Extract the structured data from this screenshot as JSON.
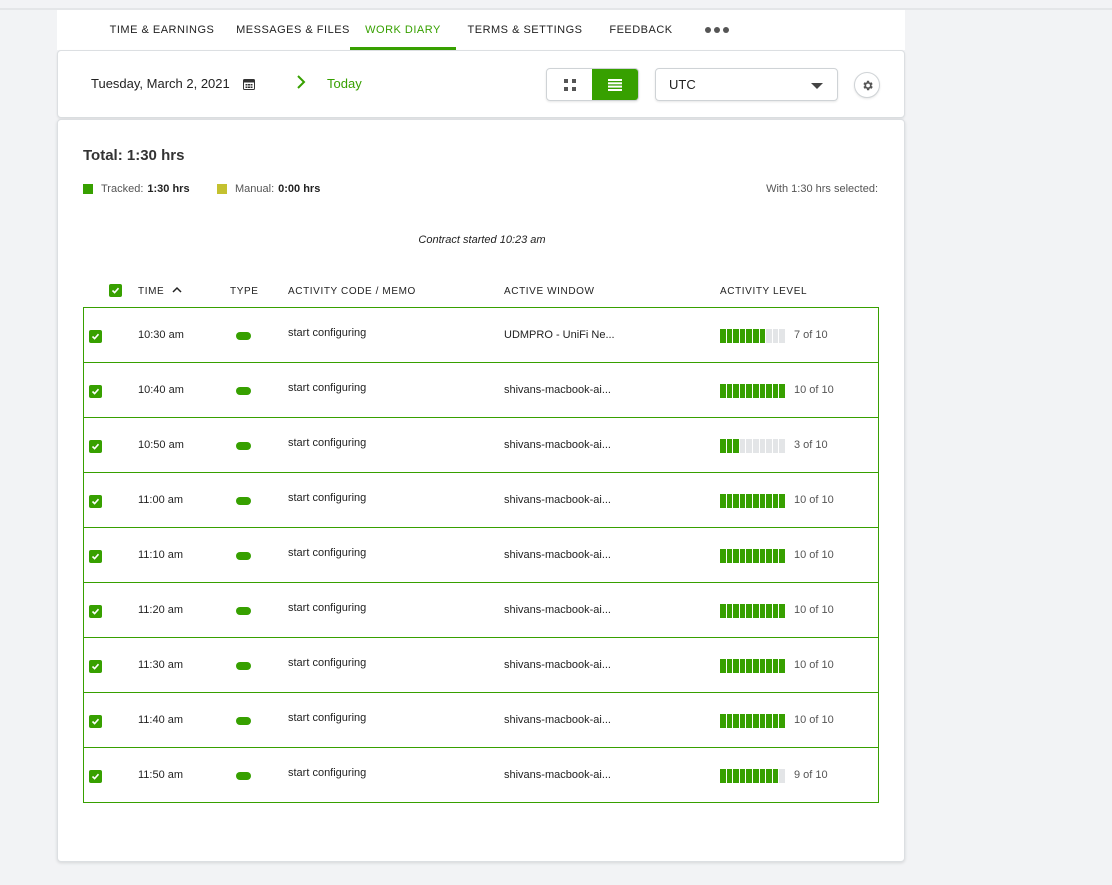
{
  "tabs": [
    {
      "label": "TIME & EARNINGS"
    },
    {
      "label": "MESSAGES & FILES"
    },
    {
      "label": "WORK DIARY"
    },
    {
      "label": "TERMS & SETTINGS"
    },
    {
      "label": "FEEDBACK"
    }
  ],
  "active_tab": "WORK DIARY",
  "toolbar": {
    "date": "Tuesday, March 2, 2021",
    "today_label": "Today",
    "timezone": "UTC",
    "view_mode": "list"
  },
  "summary": {
    "total": "Total: 1:30 hrs",
    "tracked_label": "Tracked:",
    "tracked_value": "1:30 hrs",
    "manual_label": "Manual:",
    "manual_value": "0:00 hrs",
    "selected_note": "With 1:30 hrs selected:",
    "contract_note": "Contract started 10:23 am"
  },
  "table": {
    "headers": {
      "time": "TIME",
      "type": "TYPE",
      "memo": "ACTIVITY CODE / MEMO",
      "window": "ACTIVE WINDOW",
      "activity": "ACTIVITY LEVEL"
    },
    "rows": [
      {
        "time": "10:30 am",
        "memo": "start configuring",
        "window": "UDMPRO - UniFi Ne...",
        "level": 7,
        "level_text": "7 of 10"
      },
      {
        "time": "10:40 am",
        "memo": "start configuring",
        "window": "shivans-macbook-ai...",
        "level": 10,
        "level_text": "10 of 10"
      },
      {
        "time": "10:50 am",
        "memo": "start configuring",
        "window": "shivans-macbook-ai...",
        "level": 3,
        "level_text": "3 of 10"
      },
      {
        "time": "11:00 am",
        "memo": "start configuring",
        "window": "shivans-macbook-ai...",
        "level": 10,
        "level_text": "10 of 10"
      },
      {
        "time": "11:10 am",
        "memo": "start configuring",
        "window": "shivans-macbook-ai...",
        "level": 10,
        "level_text": "10 of 10"
      },
      {
        "time": "11:20 am",
        "memo": "start configuring",
        "window": "shivans-macbook-ai...",
        "level": 10,
        "level_text": "10 of 10"
      },
      {
        "time": "11:30 am",
        "memo": "start configuring",
        "window": "shivans-macbook-ai...",
        "level": 10,
        "level_text": "10 of 10"
      },
      {
        "time": "11:40 am",
        "memo": "start configuring",
        "window": "shivans-macbook-ai...",
        "level": 10,
        "level_text": "10 of 10"
      },
      {
        "time": "11:50 am",
        "memo": "start configuring",
        "window": "shivans-macbook-ai...",
        "level": 9,
        "level_text": "9 of 10"
      }
    ]
  },
  "colors": {
    "accent": "#37a000",
    "tracked": "#37a000",
    "manual": "#c4c12f",
    "bar_empty": "#e3e5e7"
  },
  "icons": [
    "calendar-icon",
    "chevron-right-icon",
    "grid-view-icon",
    "list-view-icon",
    "caret-down-icon",
    "gear-icon",
    "checkbox-icon",
    "sort-up-icon",
    "more-icon"
  ]
}
